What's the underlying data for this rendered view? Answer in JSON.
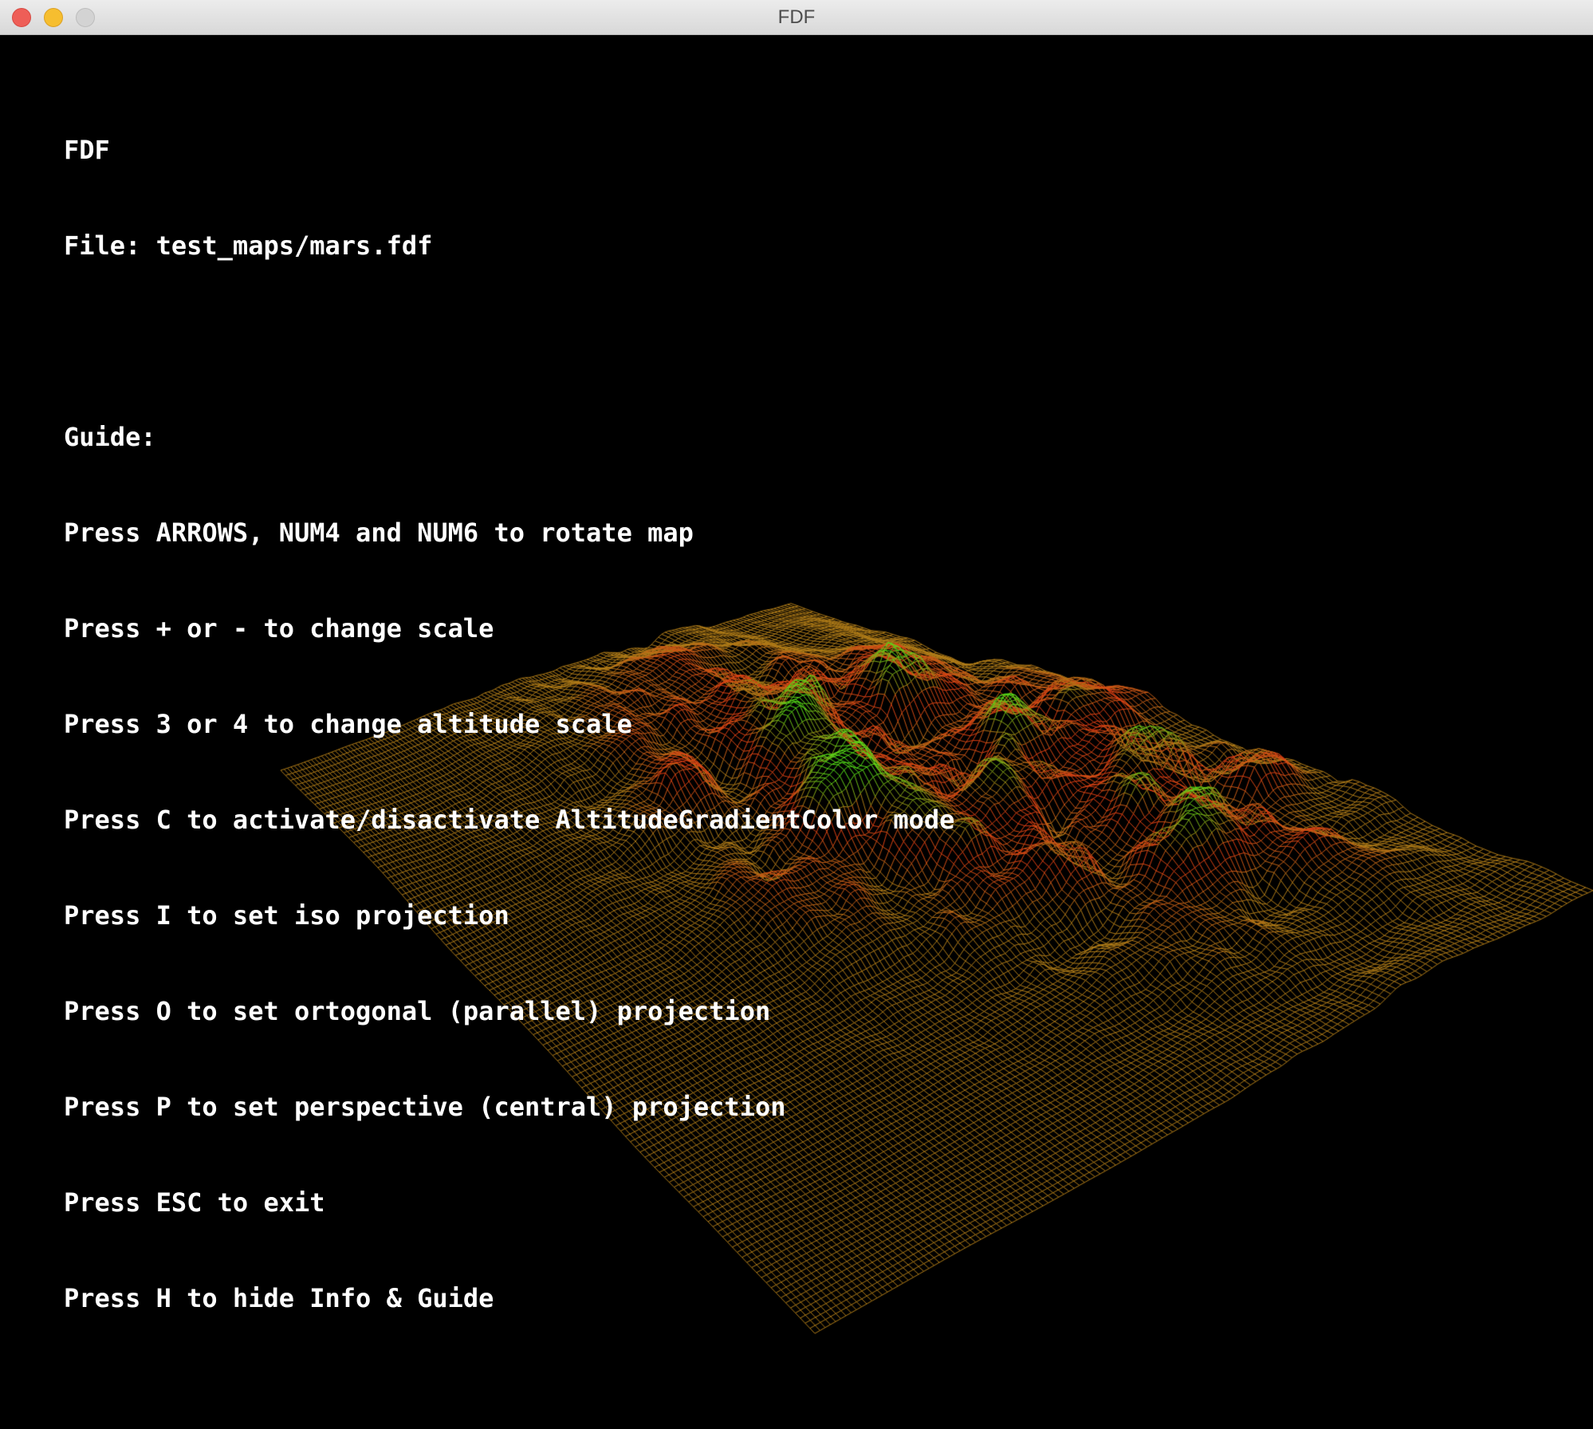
{
  "window": {
    "title": "FDF"
  },
  "info": {
    "app_name": "FDF",
    "file_line": "File: test_maps/mars.fdf",
    "guide_header": "Guide:",
    "guide_lines": [
      "Press ARROWS, NUM4 and NUM6 to rotate map",
      "Press + or - to change scale",
      "Press 3 or 4 to change altitude scale",
      "Press C to activate/disactivate AltitudeGradientColor mode",
      "Press I to set iso projection",
      "Press O to set ortogonal (parallel) projection",
      "Press P to set perspective (central) projection",
      "Press ESC to exit",
      "Press H to hide Info & Guide"
    ]
  },
  "colors": {
    "background": "#000000",
    "low_color": "#b07c18",
    "mid_color": "#e03c14",
    "high_color": "#55e018"
  },
  "icons": {
    "close": "close-icon",
    "minimize": "minimize-icon",
    "zoom": "zoom-icon"
  }
}
